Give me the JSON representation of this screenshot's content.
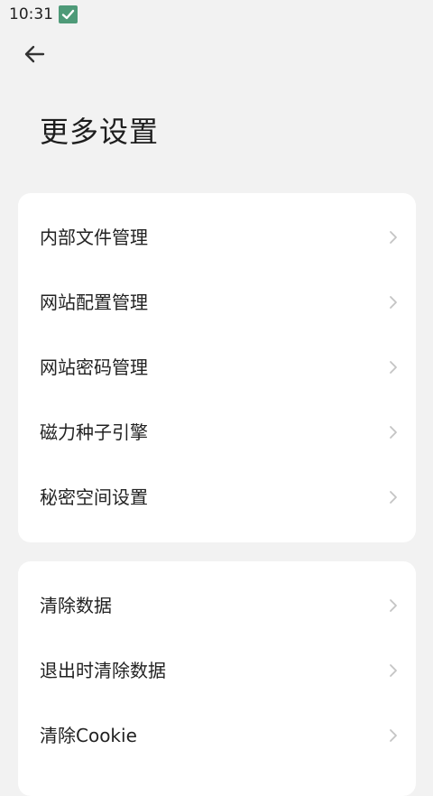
{
  "status_bar": {
    "time": "10:31",
    "notification_icon": "check-notification-icon"
  },
  "header": {
    "back_icon": "arrow-left-icon",
    "title": "更多设置"
  },
  "sections": [
    {
      "items": [
        {
          "label": "内部文件管理"
        },
        {
          "label": "网站配置管理"
        },
        {
          "label": "网站密码管理"
        },
        {
          "label": "磁力种子引擎"
        },
        {
          "label": "秘密空间设置"
        }
      ]
    },
    {
      "items": [
        {
          "label": "清除数据"
        },
        {
          "label": "退出时清除数据"
        },
        {
          "label": "清除Cookie"
        }
      ]
    }
  ],
  "colors": {
    "background": "#f2f2f2",
    "card": "#ffffff",
    "status_icon": "#4e9a78",
    "chevron": "#c4c4c4"
  }
}
